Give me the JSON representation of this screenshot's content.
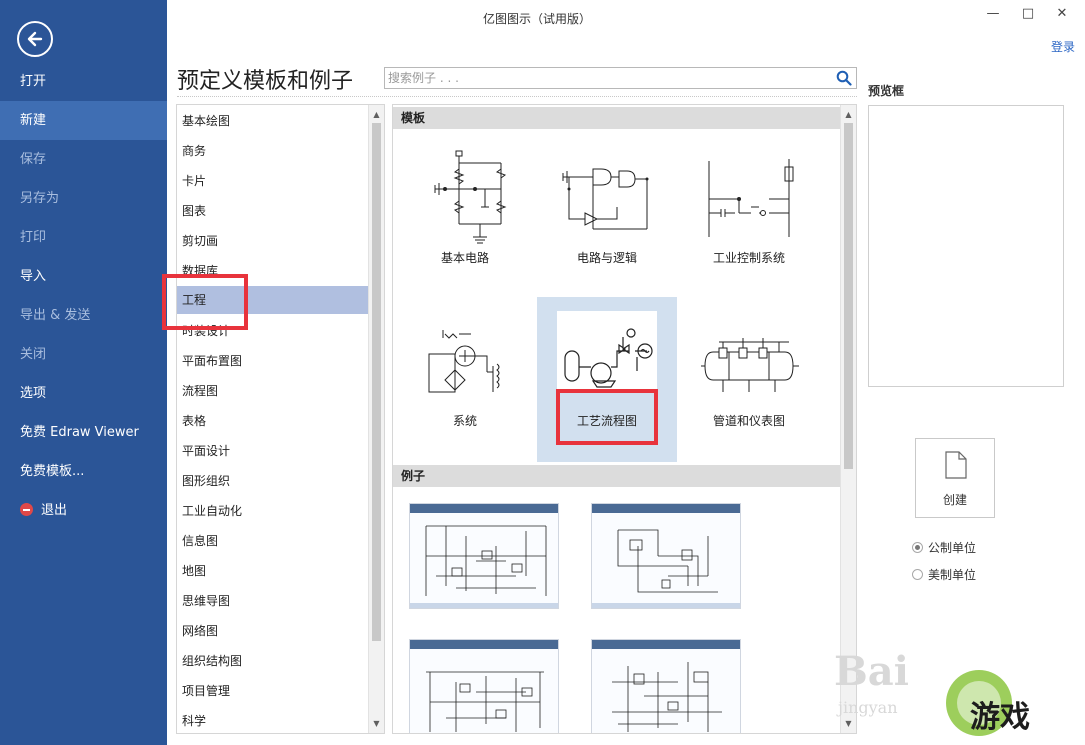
{
  "window": {
    "title": "亿图图示（试用版）",
    "login": "登录",
    "controls": [
      "—",
      "□",
      "✕"
    ]
  },
  "sidebar": {
    "items": [
      {
        "label": "打开",
        "state": "normal"
      },
      {
        "label": "新建",
        "state": "active"
      },
      {
        "label": "保存",
        "state": "dim"
      },
      {
        "label": "另存为",
        "state": "dim"
      },
      {
        "label": "打印",
        "state": "dim"
      },
      {
        "label": "导入",
        "state": "normal"
      },
      {
        "label": "导出 & 发送",
        "state": "dim"
      },
      {
        "label": "关闭",
        "state": "dim"
      },
      {
        "label": "选项",
        "state": "normal"
      },
      {
        "label": "免费 Edraw Viewer",
        "state": "normal"
      },
      {
        "label": "免费模板...",
        "state": "normal"
      },
      {
        "label": "退出",
        "state": "normal"
      }
    ]
  },
  "header": {
    "title": "预定义模板和例子",
    "search_placeholder": "搜索例子 . . ."
  },
  "categories": {
    "items": [
      "基本绘图",
      "商务",
      "卡片",
      "图表",
      "剪切画",
      "数据库",
      "工程",
      "时装设计",
      "平面布置图",
      "流程图",
      "表格",
      "平面设计",
      "图形组织",
      "工业自动化",
      "信息图",
      "地图",
      "思维导图",
      "网络图",
      "组织结构图",
      "项目管理",
      "科学"
    ],
    "selected": "工程"
  },
  "gallery": {
    "templates_header": "模板",
    "examples_header": "例子",
    "templates": [
      "基本电路",
      "电路与逻辑",
      "工业控制系统",
      "系统",
      "工艺流程图",
      "管道和仪表图"
    ],
    "selected_template": "工艺流程图"
  },
  "preview": {
    "label": "预览框",
    "create": "创建",
    "units": [
      "公制单位",
      "美制单位"
    ],
    "selected_unit": "公制单位"
  },
  "watermark": {
    "baidu": "Bai",
    "jingyan": "jingyan",
    "site": "游戏"
  },
  "colors": {
    "sidebar": "#2b5597",
    "sidebar_active": "#3f6eb3",
    "selection": "#b0bfe0",
    "highlight": "#e8333c",
    "link": "#2b66c4"
  }
}
